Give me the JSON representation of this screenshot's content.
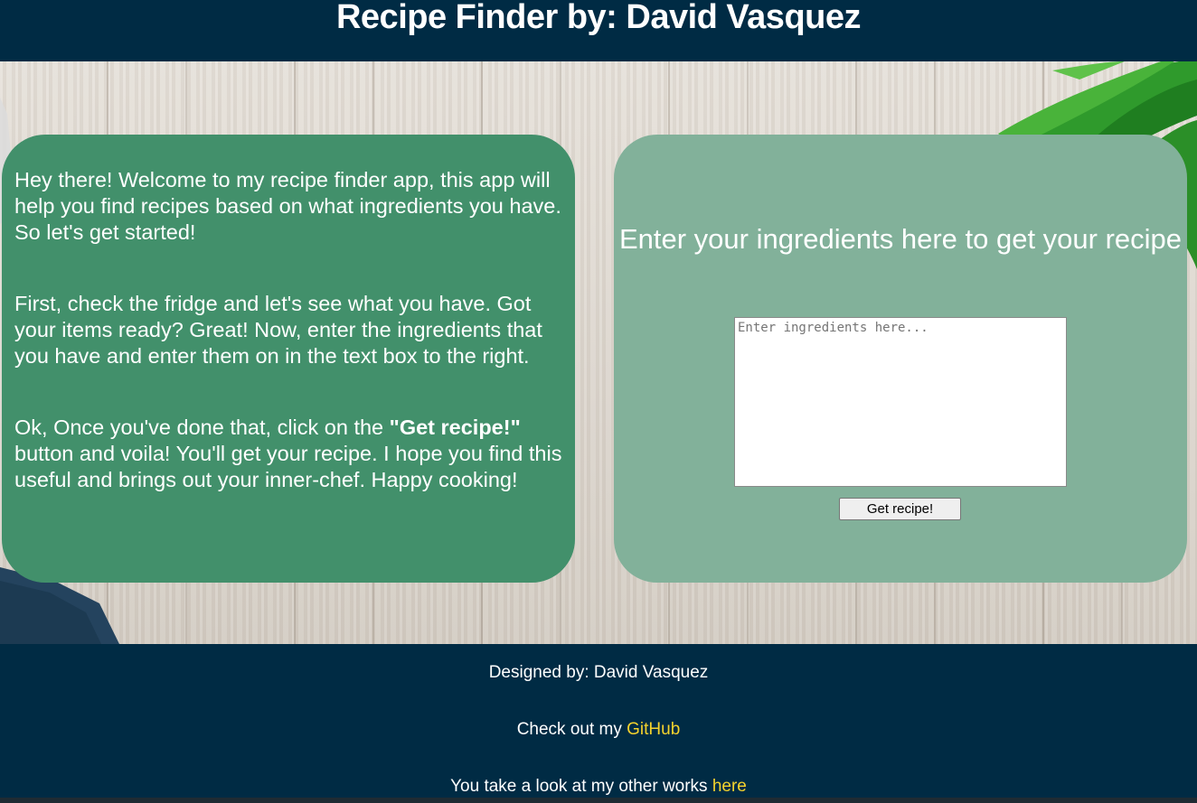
{
  "header": {
    "title": "Recipe Finder by: David Vasquez"
  },
  "intro": {
    "paragraph1": "Hey there! Welcome to my recipe finder app, this app will help you find recipes based on what ingredients you have. So let's get started!",
    "paragraph2": "First, check the fridge and let's see what you have. Got your items ready? Great! Now, enter the ingredients that you have and enter them on in the text box to the right.",
    "paragraph3_before": "Ok, Once you've done that, click on the ",
    "paragraph3_bold": "\"Get recipe!\"",
    "paragraph3_after": " button and voila! You'll get your recipe. I hope you find this useful and brings out your inner-chef. Happy cooking!"
  },
  "form": {
    "heading": "Enter your ingredients here to get your recipe",
    "ingredients_value": "",
    "ingredients_placeholder": "Enter ingredients here...",
    "submit_label": "Get recipe!"
  },
  "footer": {
    "designed_by": "Designed by: David Vasquez",
    "github_prefix": "Check out my ",
    "github_link": "GitHub",
    "works_prefix": "You take a look at my other works ",
    "works_link": "here",
    "link_color": "#f6d32d"
  },
  "colors": {
    "header_bg": "#002b44",
    "left_panel": "#42906b",
    "right_panel": "#82b19a"
  }
}
